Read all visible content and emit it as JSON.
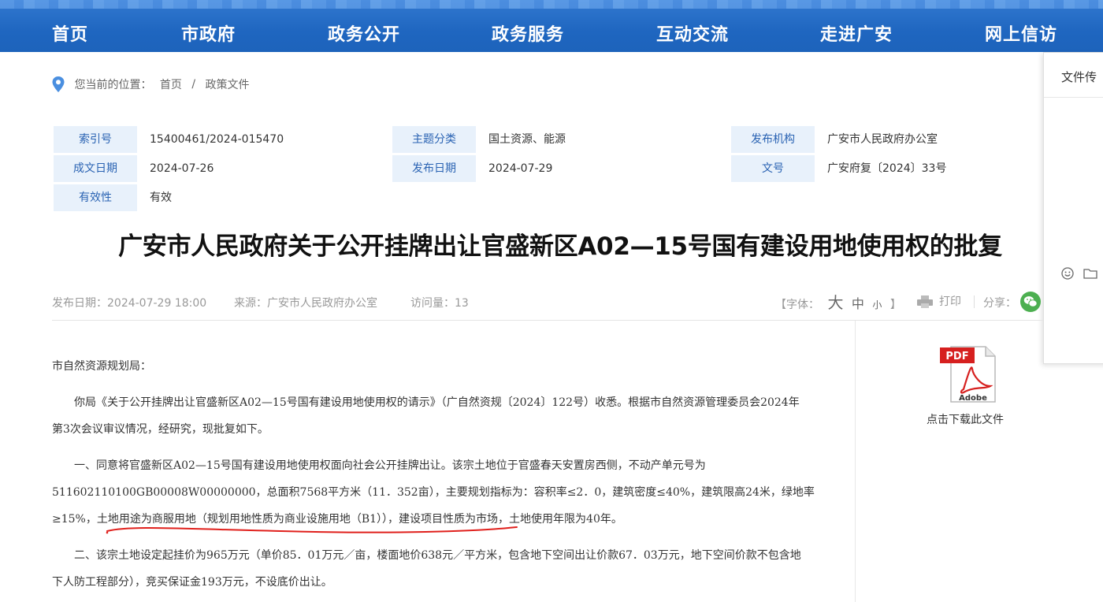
{
  "nav": {
    "items": [
      "首页",
      "市政府",
      "政务公开",
      "政务服务",
      "互动交流",
      "走进广安",
      "网上信访"
    ]
  },
  "float_panel": {
    "title": "文件传"
  },
  "breadcrumb": {
    "prefix": "您当前的位置：",
    "items": [
      "首页",
      "政策文件"
    ],
    "separator": "/"
  },
  "meta": {
    "index_label": "索引号",
    "index_value": "15400461/2024-015470",
    "topic_label": "主题分类",
    "topic_value": "国土资源、能源",
    "org_label": "发布机构",
    "org_value": "广安市人民政府办公室",
    "date_label": "成文日期",
    "date_value": "2024-07-26",
    "pub_label": "发布日期",
    "pub_value": "2024-07-29",
    "doc_label": "文号",
    "doc_value": "广安府复〔2024〕33号",
    "valid_label": "有效性",
    "valid_value": "有效"
  },
  "article": {
    "title": "广安市人民政府关于公开挂牌出让官盛新区A02—15号国有建设用地使用权的批复",
    "publish_time": "发布日期：2024-07-29 18:00",
    "source": "来源：广安市人民政府办公室",
    "visits": "访问量：13",
    "font_label": "【字体：",
    "font_big": "大",
    "font_mid": "中",
    "font_small": "小",
    "font_end": "】",
    "print": "打印",
    "share": "分享：",
    "lines": [
      "市自然资源规划局：",
      "　　你局《关于公开挂牌出让官盛新区A02—15号国有建设用地使用权的请示》（广自然资规〔2024〕122号）收悉。根据市自然资源管理委员会2024年",
      "第3次会议审议情况，经研究，现批复如下。",
      "　　一、同意将官盛新区A02—15号国有建设用地使用权面向社会公开挂牌出让。该宗土地位于官盛春天安置房西侧，不动产单元号为",
      "511602110100GB00008W00000000，总面积7568平方米（11．352亩），主要规划指标为：容积率≤2．0，建筑密度≤40%，建筑限高24米，绿地率",
      "≥15%，土地用途为商服用地（规划用地性质为商业设施用地（B1）），建设项目性质为市场，土地使用年限为40年。",
      "　　二、该宗土地设定起挂价为965万元（单价85．01万元／亩，楼面地价638元／平方米，包含地下空间出让价款67．03万元，地下空间价款不包含地",
      "下人防工程部分），竞买保证金193万元，不设底价出让。"
    ]
  },
  "attachment": {
    "pdf_text": "PDF",
    "adobe_text": "Adobe",
    "link": "点击下载此文件"
  },
  "colors": {
    "nav_bg": "#1f66c0",
    "label_bg": "#e8f1fb",
    "label_text": "#2a63b3",
    "annotation": "#e0201c"
  }
}
